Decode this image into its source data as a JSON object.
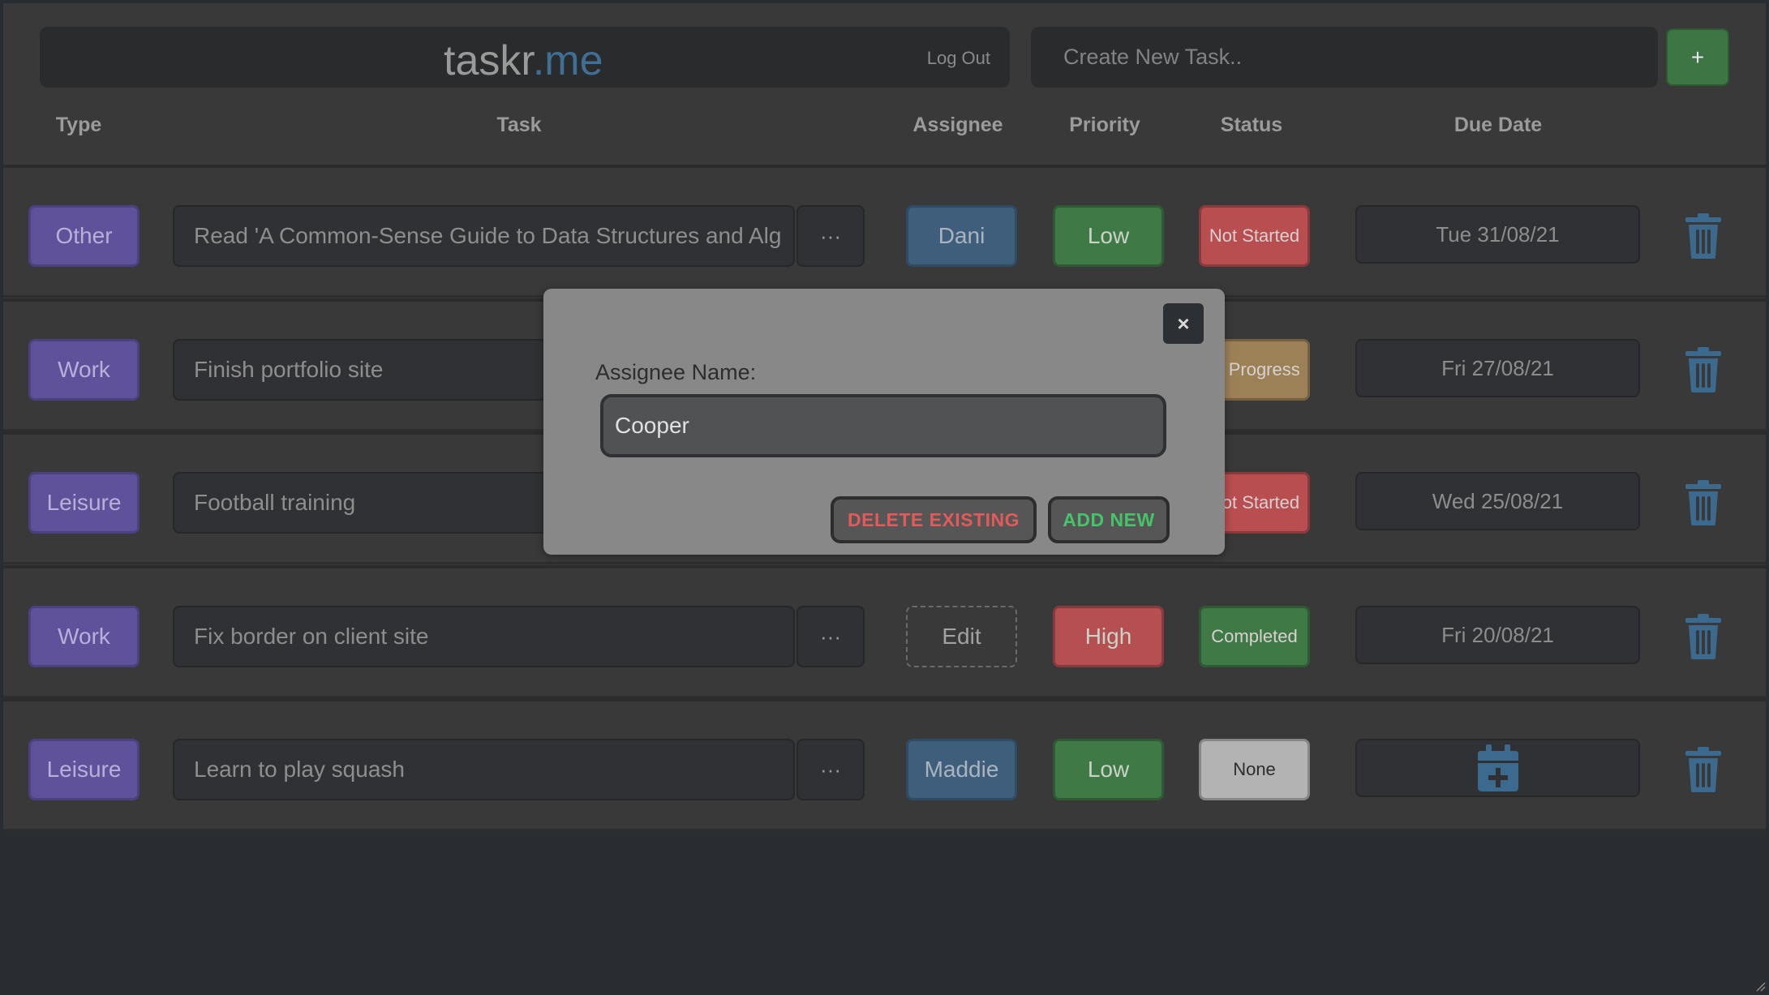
{
  "header": {
    "brand_main": "taskr",
    "brand_tld": ".me",
    "logout_label": "Log Out",
    "new_task_placeholder": "Create New Task..",
    "add_button_label": "+"
  },
  "columns": {
    "type": "Type",
    "task": "Task",
    "assignee": "Assignee",
    "priority": "Priority",
    "status": "Status",
    "due_date": "Due Date"
  },
  "tasks": [
    {
      "type": "Other",
      "task": "Read 'A Common-Sense Guide to Data Structures and Alg",
      "menu": "···",
      "assignee": "Dani",
      "priority": "Low",
      "priority_color": "#3f7a46",
      "status": "Not Started",
      "status_color": "#b94e50",
      "due": "Tue 31/08/21"
    },
    {
      "type": "Work",
      "task": "Finish portfolio site",
      "menu": "···",
      "assignee": "",
      "priority": "",
      "priority_color": "",
      "status": "In Progress",
      "status_color": "#9c8157",
      "due": "Fri 27/08/21"
    },
    {
      "type": "Leisure",
      "task": "Football training",
      "menu": "···",
      "assignee": "",
      "priority": "",
      "priority_color": "",
      "status": "Not Started",
      "status_color": "#b94e50",
      "due": "Wed 25/08/21"
    },
    {
      "type": "Work",
      "task": "Fix border on client site",
      "menu": "···",
      "assignee": "Edit",
      "priority": "High",
      "priority_color": "#b64f52",
      "status": "Completed",
      "status_color": "#3f7a46",
      "due": "Fri 20/08/21"
    },
    {
      "type": "Leisure",
      "task": "Learn to play squash",
      "menu": "···",
      "assignee": "Maddie",
      "priority": "Low",
      "priority_color": "#3f7a46",
      "status": "None",
      "status_color": "#b3b3b3",
      "due": ""
    }
  ],
  "modal": {
    "close_label": "×",
    "label": "Assignee Name:",
    "input_value": "Cooper",
    "delete_label": "DELETE EXISTING",
    "add_label": "ADD NEW"
  },
  "colors": {
    "type_bg": "#60529a",
    "assignee_bg": "#3f5e7c",
    "accent_blue": "#3f6f94",
    "add_green": "#3d7545"
  },
  "icons": {
    "trash": "trash-icon",
    "calendar_add": "calendar-plus-icon",
    "close": "close-icon"
  }
}
